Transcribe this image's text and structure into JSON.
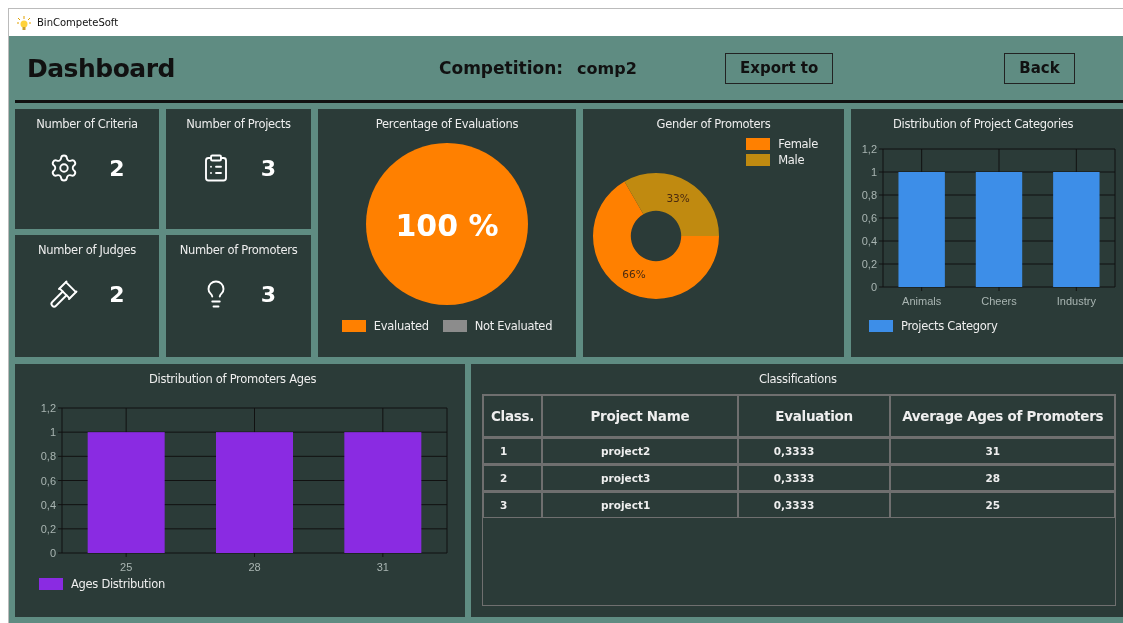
{
  "window": {
    "title": "BinCompeteSoft"
  },
  "header": {
    "title": "Dashboard",
    "competition_label": "Competition:",
    "competition_value": "comp2",
    "buttons": [
      "Export to",
      "Back"
    ]
  },
  "stats": [
    {
      "kind": "gear",
      "label": "Number of Criteria",
      "value": "2"
    },
    {
      "kind": "clipboard",
      "label": "Number of Projects",
      "value": "3"
    },
    {
      "kind": "gavel",
      "label": "Number of Judges",
      "value": "2"
    },
    {
      "kind": "bulb",
      "label": "Number of Promoters",
      "value": "3"
    }
  ],
  "evaluations": {
    "title": "Percentage of Evaluations",
    "center_label": "100 %",
    "slices": [
      {
        "color": "#ff8000"
      },
      {
        "color": "#8c8c8c"
      }
    ],
    "chart_data": {
      "type": "pie",
      "categories": [
        "Evaluated",
        "Not Evaluated"
      ],
      "values": [
        100,
        0
      ]
    }
  },
  "gender": {
    "title": "Gender of Promoters",
    "slices": [
      {
        "color": "#ff8000"
      },
      {
        "color": "#c08a10"
      }
    ],
    "chart_data": {
      "type": "donut",
      "categories": [
        "Female",
        "Male"
      ],
      "values": [
        66,
        33
      ],
      "value_labels": [
        "66%",
        "33%"
      ]
    }
  },
  "categories": {
    "title": "Distribution of Project Categories",
    "chart_data": {
      "type": "bar",
      "grid": true,
      "categories": [
        "Animals",
        "Cheers",
        "Industry"
      ],
      "series": [
        {
          "name": "Projects Category",
          "color": "#3d8ee8",
          "values": [
            1,
            1,
            1
          ]
        }
      ],
      "ylim": [
        0,
        1.2
      ],
      "yticks": [
        {
          "value": 0,
          "label": "0"
        },
        {
          "value": 0.2,
          "label": "0,2"
        },
        {
          "value": 0.4,
          "label": "0,4"
        },
        {
          "value": 0.6,
          "label": "0,6"
        },
        {
          "value": 0.8,
          "label": "0,8"
        },
        {
          "value": 1,
          "label": "1"
        },
        {
          "value": 1.2,
          "label": "1,2"
        }
      ]
    }
  },
  "ages": {
    "title": "Distribution of Promoters Ages",
    "chart_data": {
      "type": "bar",
      "grid": true,
      "categories": [
        "25",
        "28",
        "31"
      ],
      "series": [
        {
          "name": "Ages Distribution",
          "color": "#8a2be2",
          "values": [
            1,
            1,
            1
          ]
        }
      ],
      "ylim": [
        0,
        1.2
      ],
      "yticks": [
        {
          "value": 0,
          "label": "0"
        },
        {
          "value": 0.2,
          "label": "0,2"
        },
        {
          "value": 0.4,
          "label": "0,4"
        },
        {
          "value": 0.6,
          "label": "0,6"
        },
        {
          "value": 0.8,
          "label": "0,8"
        },
        {
          "value": 1,
          "label": "1"
        },
        {
          "value": 1.2,
          "label": "1,2"
        }
      ]
    }
  },
  "classifications": {
    "title": "Classifications",
    "columns": [
      "Class.",
      "Project Name",
      "Evaluation",
      "Average Ages of Promoters"
    ],
    "rows": [
      [
        "1",
        "project2",
        "0,3333",
        "31"
      ],
      [
        "2",
        "project3",
        "0,3333",
        "28"
      ],
      [
        "3",
        "project1",
        "0,3333",
        "25"
      ]
    ]
  }
}
